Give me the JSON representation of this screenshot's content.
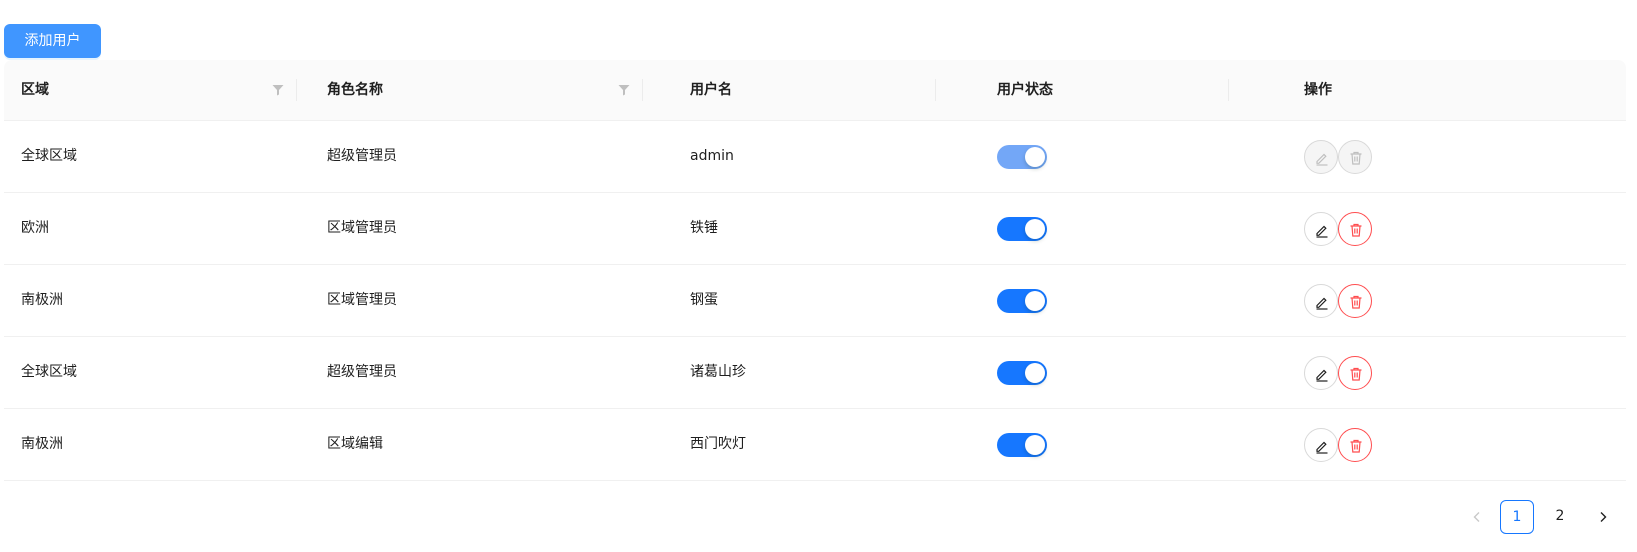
{
  "toolbar": {
    "add_user_label": "添加用户"
  },
  "table": {
    "columns": [
      {
        "label": "区域",
        "filterable": true
      },
      {
        "label": "角色名称",
        "filterable": true
      },
      {
        "label": "用户名",
        "filterable": false
      },
      {
        "label": "用户状态",
        "filterable": false
      },
      {
        "label": "操作",
        "filterable": false
      }
    ],
    "rows": [
      {
        "region": "全球区域",
        "role": "超级管理员",
        "username": "admin",
        "status_on": true,
        "actions_disabled": true
      },
      {
        "region": "欧洲",
        "role": "区域管理员",
        "username": "铁锤",
        "status_on": true,
        "actions_disabled": false
      },
      {
        "region": "南极洲",
        "role": "区域管理员",
        "username": "钢蛋",
        "status_on": true,
        "actions_disabled": false
      },
      {
        "region": "全球区域",
        "role": "超级管理员",
        "username": "诸葛山珍",
        "status_on": true,
        "actions_disabled": false
      },
      {
        "region": "南极洲",
        "role": "区域编辑",
        "username": "西门吹灯",
        "status_on": true,
        "actions_disabled": false
      }
    ]
  },
  "pagination": {
    "pages": [
      "1",
      "2"
    ],
    "current": "1",
    "prev_icon": "chevron-left-icon",
    "next_icon": "chevron-right-icon"
  },
  "colors": {
    "primary": "#1677ff",
    "button": "#4096ff",
    "danger": "#ff4d4f"
  }
}
